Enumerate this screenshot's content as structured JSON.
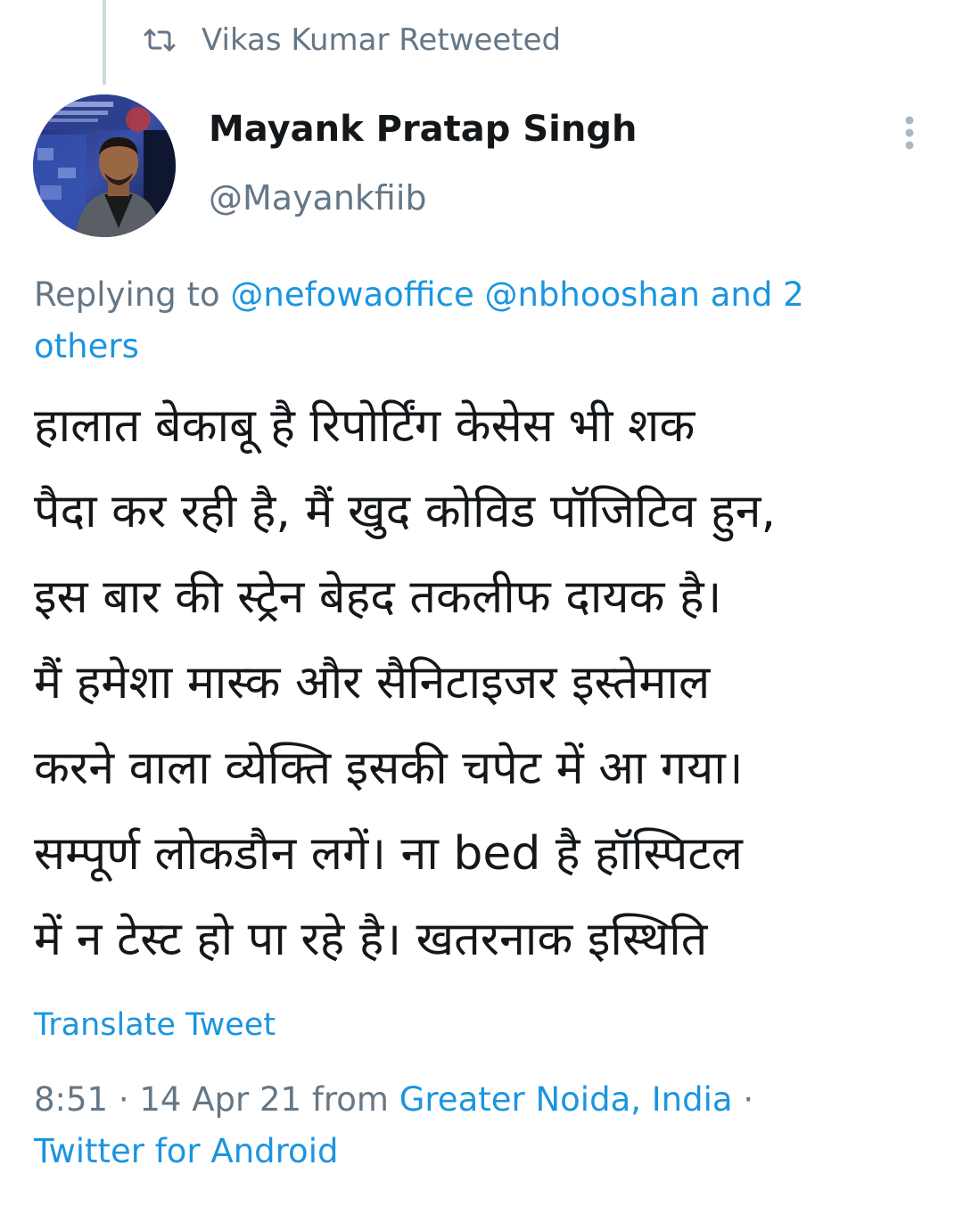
{
  "retweet": {
    "icon": "retweet-icon",
    "text": "Vikas Kumar Retweeted"
  },
  "author": {
    "display_name": "Mayank Pratap Singh",
    "handle": "@Mayankfiib"
  },
  "reply": {
    "prefix": "Replying to",
    "mention_1": "@nefowaoffice",
    "mention_2": "@nbhooshan",
    "others_line_1": "and 2",
    "others_line_2": "others"
  },
  "tweet": {
    "lines": [
      "हालात बेकाबू है रिपोर्टिंग केसेस भी शक",
      "पैदा कर रही है, मैं खुद कोविड पॉजिटिव हुन,",
      "इस बार की स्ट्रेन बेहद तकलीफ दायक है।",
      "मैं हमेशा मास्क और सैनिटाइजर इस्तेमाल",
      "करने वाला व्येक्ति इसकी चपेट में आ गया।",
      "सम्पूर्ण लोकडौन लगें। ना bed है हॉस्पिटल",
      "में न टेस्ट हो पा रहे है। खतरनाक इस्थिति"
    ]
  },
  "translate_label": "Translate Tweet",
  "meta": {
    "time": "8:51",
    "date": "14 Apr 21",
    "from_label": "from",
    "location": "Greater Noida, India",
    "separator": "·",
    "source": "Twitter for Android"
  },
  "colors": {
    "link": "#1b95e0",
    "secondary_text": "#657786",
    "primary_text": "#14171a"
  }
}
